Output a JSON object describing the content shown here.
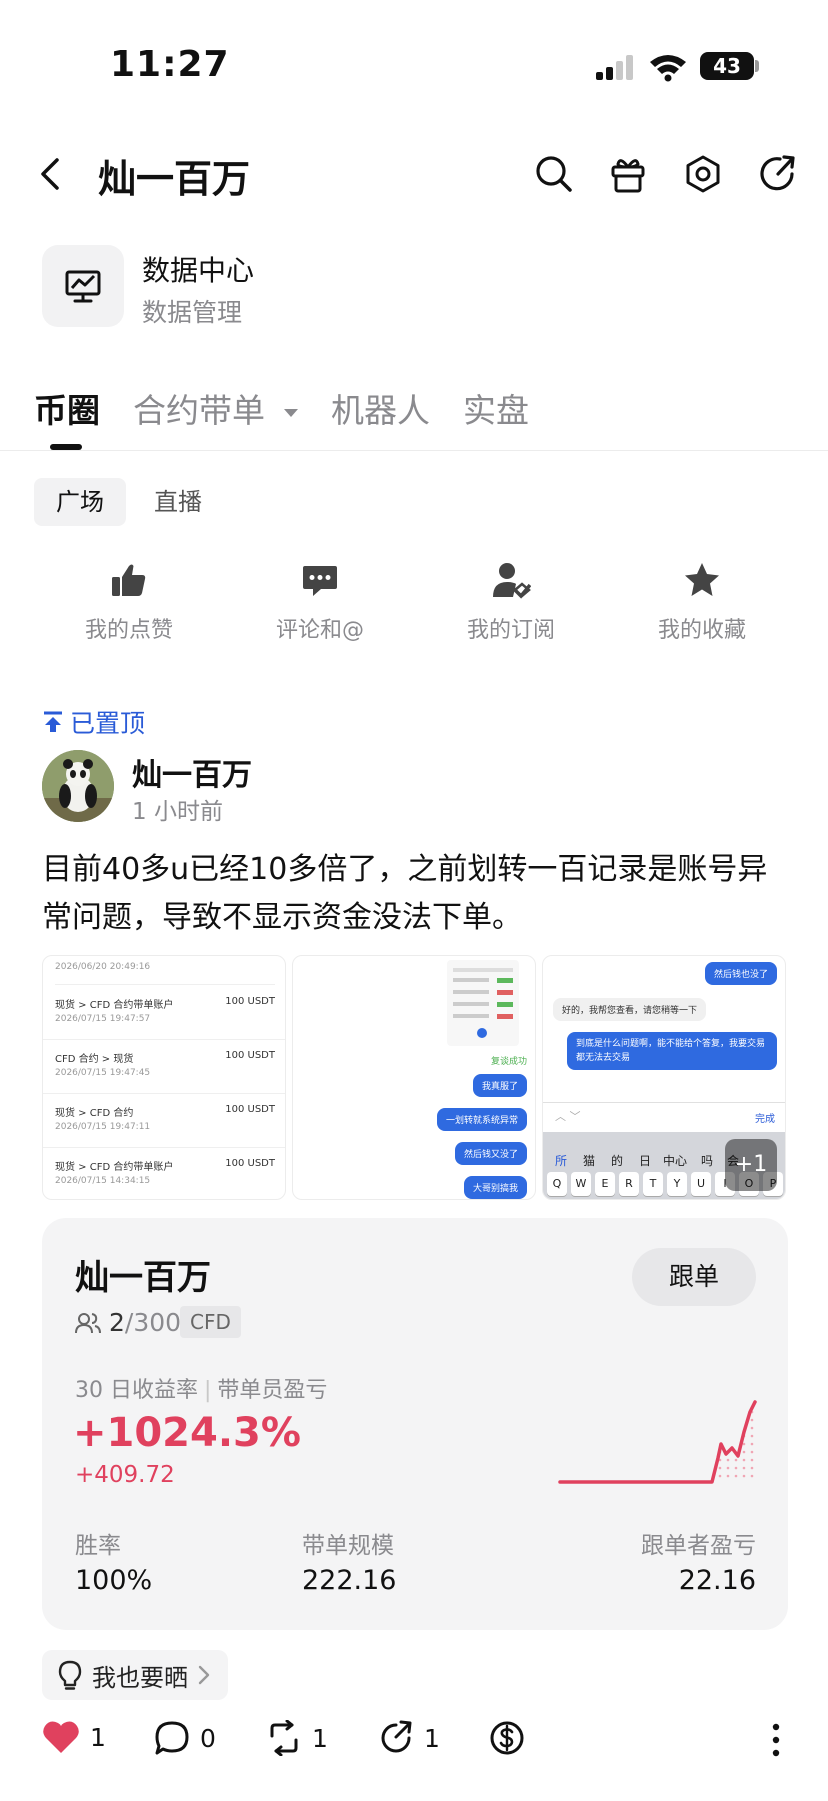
{
  "status_bar": {
    "time": "11:27",
    "battery": "43"
  },
  "header": {
    "title": "灿一百万",
    "icons": [
      "back-arrow-icon",
      "search-icon",
      "gift-icon",
      "settings-icon",
      "share-icon"
    ]
  },
  "data_center": {
    "title": "数据中心",
    "subtitle": "数据管理",
    "icon": "chart-monitor-icon"
  },
  "tabs": [
    {
      "label": "币圈",
      "active": true
    },
    {
      "label": "合约带单",
      "active": false,
      "has_dropdown": true
    },
    {
      "label": "机器人",
      "active": false
    },
    {
      "label": "实盘",
      "active": false
    }
  ],
  "subtabs": [
    {
      "label": "广场",
      "active": true
    },
    {
      "label": "直播",
      "active": false
    }
  ],
  "quick_actions": [
    {
      "label": "我的点赞",
      "icon": "thumbs-up-icon"
    },
    {
      "label": "评论和@",
      "icon": "comment-icon"
    },
    {
      "label": "我的订阅",
      "icon": "subscribe-user-icon"
    },
    {
      "label": "我的收藏",
      "icon": "star-icon"
    }
  ],
  "post": {
    "pinned_label": "已置顶",
    "author": "灿一百万",
    "time": "1 小时前",
    "text": "目前40多u已经10多倍了，之前划转一百记录是账号异常问题，导致不显示资金没法下单。",
    "extra_images": "+1",
    "thumb1": {
      "top_date": "2026/06/20 20:49:16",
      "rows": [
        {
          "title": "现货 > CFD 合约带单账户",
          "date": "2026/07/15 19:47:57",
          "amount": "100 USDT"
        },
        {
          "title": "CFD 合约 > 现货",
          "date": "2026/07/15 19:47:45",
          "amount": "100 USDT"
        },
        {
          "title": "现货 > CFD 合约",
          "date": "2026/07/15 19:47:11",
          "amount": "100 USDT"
        },
        {
          "title": "现货 > CFD 合约带单账户",
          "date": "2026/07/15 14:34:15",
          "amount": "100 USDT"
        }
      ]
    },
    "thumb2": {
      "success_text": "复谈成功",
      "bubbles": [
        "我真服了",
        "一划转就系统异常",
        "然后钱又没了",
        "大哥别搞我"
      ]
    },
    "thumb3": {
      "bubble_top": "然后钱也没了",
      "reply": "好的，我帮您查看，请您稍等一下",
      "bubble_long": "到底是什么问题啊，能不能给个答复，我要交易都无法去交易",
      "done_label": "完成",
      "candidates": [
        "所",
        "猫",
        "的",
        "日",
        "中心",
        "吗",
        "会"
      ],
      "keys": [
        "Q",
        "W",
        "E",
        "R",
        "T",
        "Y",
        "U",
        "I",
        "O",
        "P"
      ]
    }
  },
  "copy_card": {
    "name": "灿一百万",
    "follow_button": "跟单",
    "followers_current": "2",
    "followers_max": "/300",
    "tag": "CFD",
    "metric_label_1": "30 日收益率",
    "metric_label_2": "带单员盈亏",
    "roi": "+1024.3%",
    "pnl": "+409.72",
    "win_rate_label": "胜率",
    "win_rate": "100%",
    "scale_label": "带单规模",
    "scale": "222.16",
    "follower_pnl_label": "跟单者盈亏",
    "follower_pnl": "22.16",
    "accent_color": "#e0415e"
  },
  "cta": {
    "label": "我也要晒"
  },
  "bottom_actions": {
    "likes": "1",
    "comments": "0",
    "reposts": "1",
    "shares": "1"
  }
}
